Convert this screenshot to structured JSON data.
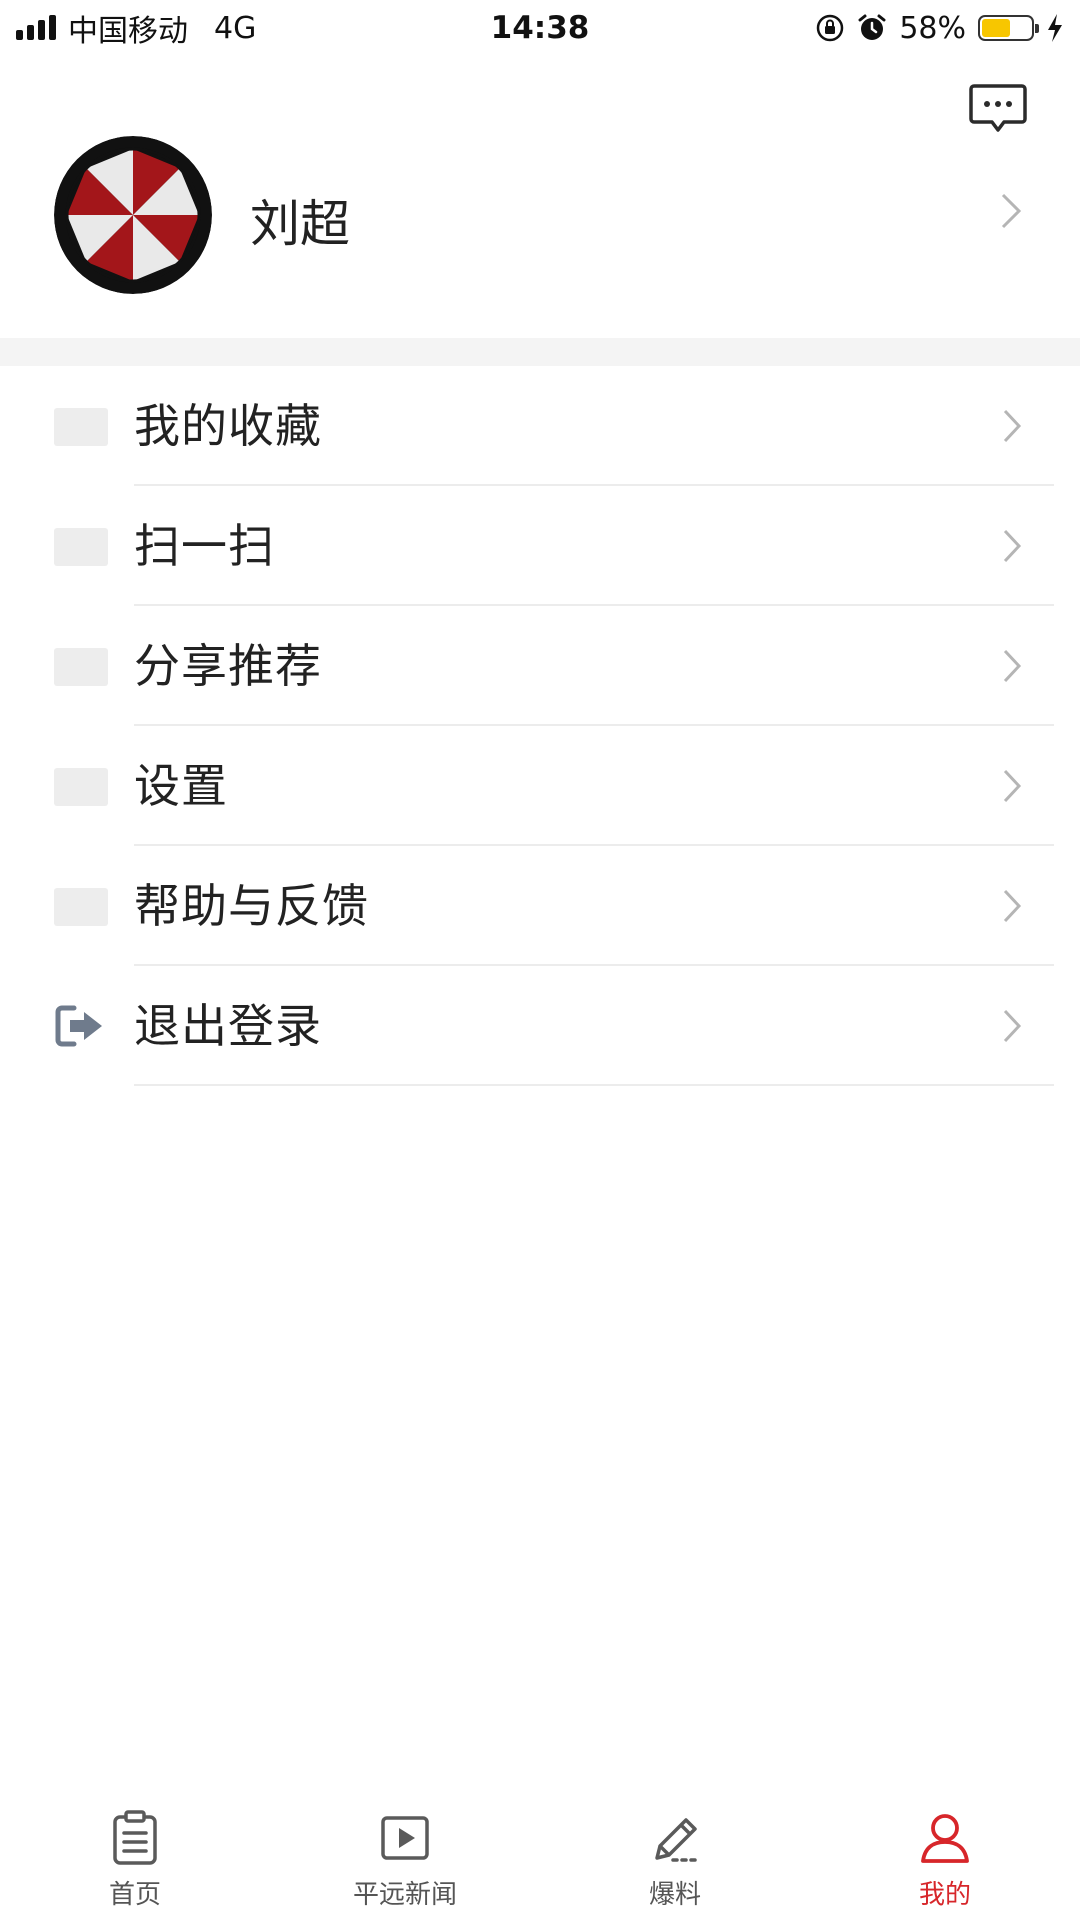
{
  "status_bar": {
    "carrier": "中国移动",
    "network": "4G",
    "time": "14:38",
    "battery_percent": "58%",
    "battery_level": 0.58,
    "battery_color": "#f7c600"
  },
  "header": {
    "message_icon": "chat-bubble-dots-icon"
  },
  "profile": {
    "username": "刘超",
    "avatar": "umbrella-logo-avatar"
  },
  "menu": {
    "items": [
      {
        "label": "我的收藏",
        "icon": "placeholder-icon"
      },
      {
        "label": "扫一扫",
        "icon": "placeholder-icon"
      },
      {
        "label": "分享推荐",
        "icon": "placeholder-icon"
      },
      {
        "label": "设置",
        "icon": "placeholder-icon"
      },
      {
        "label": "帮助与反馈",
        "icon": "placeholder-icon"
      },
      {
        "label": "退出登录",
        "icon": "logout-icon"
      }
    ]
  },
  "tabbar": {
    "active_color": "#d7262a",
    "tabs": [
      {
        "label": "首页",
        "icon": "clipboard-icon"
      },
      {
        "label": "平远新闻",
        "icon": "play-video-icon"
      },
      {
        "label": "爆料",
        "icon": "pencil-icon"
      },
      {
        "label": "我的",
        "icon": "user-icon",
        "active": true
      }
    ]
  }
}
